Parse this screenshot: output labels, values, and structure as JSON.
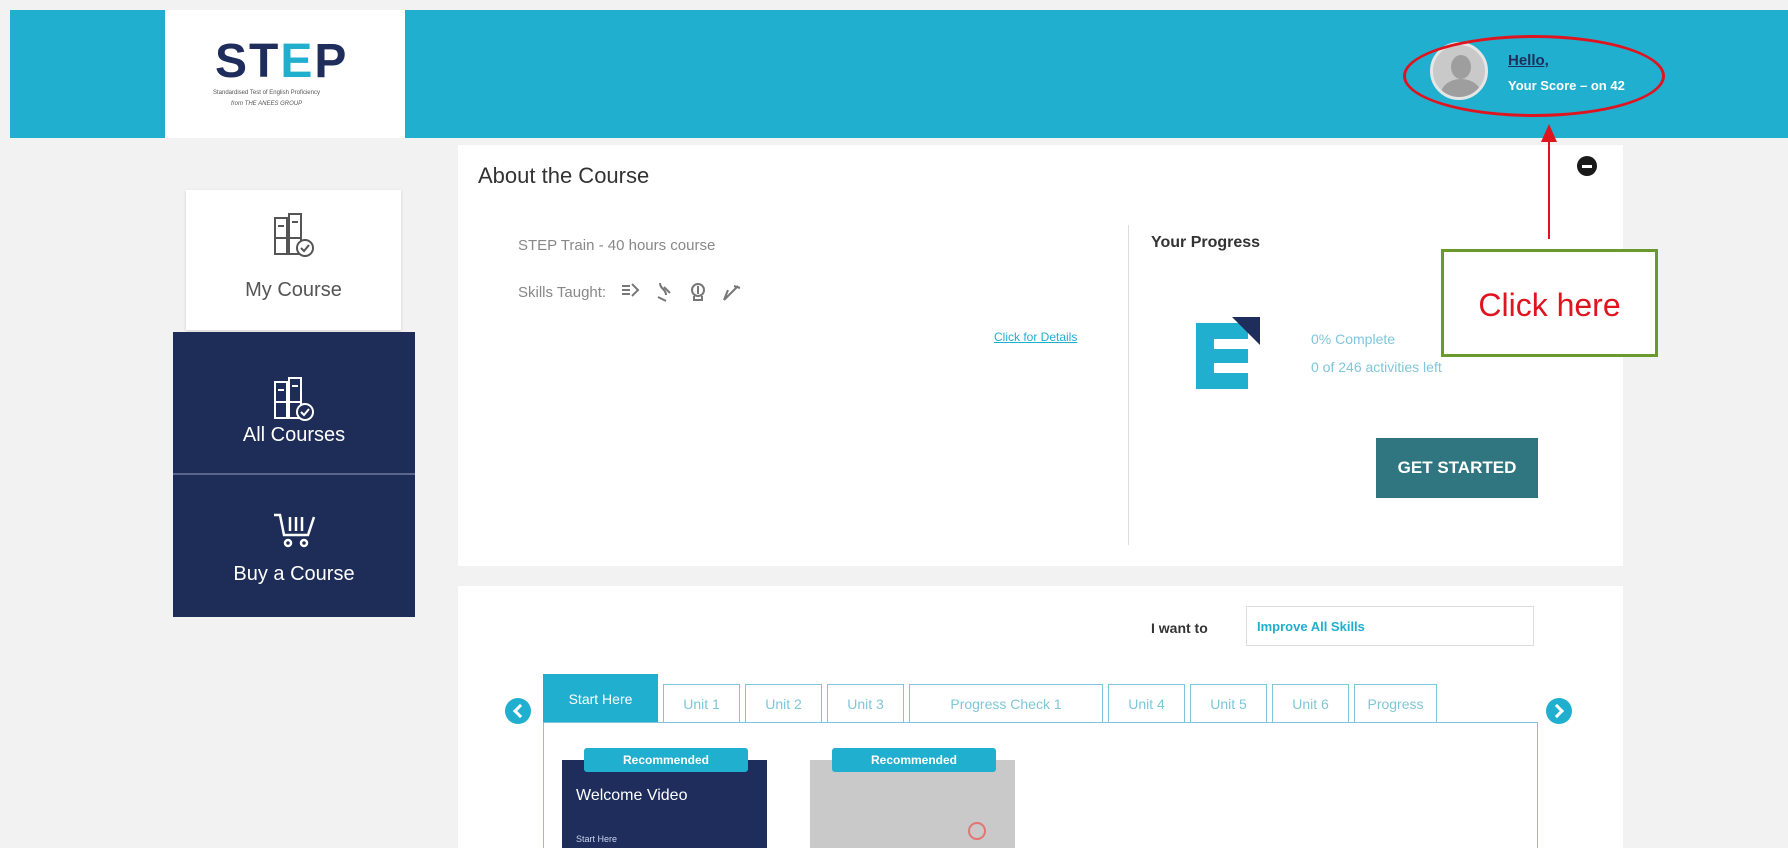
{
  "header": {
    "logo_main": "STEP",
    "logo_tagline": "Standardised Test of English Proficiency",
    "logo_byline": "from THE ANEES GROUP",
    "greeting": "Hello,",
    "score": "Your Score – on 42"
  },
  "sidebar": {
    "my_course": "My Course",
    "all_courses": "All Courses",
    "buy_course": "Buy a Course"
  },
  "about": {
    "title": "About the Course",
    "course_name": "STEP Train - 40 hours course",
    "skills_label": "Skills Taught:",
    "details_link": "Click for Details",
    "progress_title": "Your Progress",
    "percent_complete": "0% Complete",
    "activities_left": "0 of 246 activities left",
    "get_started": "GET STARTED"
  },
  "annotation": {
    "click_here": "Click here"
  },
  "filter": {
    "label": "I want to",
    "value": "Improve All Skills"
  },
  "tabs": [
    {
      "label": "Start Here",
      "width": 115
    },
    {
      "label": "Unit 1",
      "width": 77
    },
    {
      "label": "Unit 2",
      "width": 77
    },
    {
      "label": "Unit 3",
      "width": 77
    },
    {
      "label": "Progress Check 1",
      "width": 194
    },
    {
      "label": "Unit 4",
      "width": 77
    },
    {
      "label": "Unit 5",
      "width": 77
    },
    {
      "label": "Unit 6",
      "width": 77
    },
    {
      "label": "Progress",
      "width": 83
    }
  ],
  "cards": [
    {
      "badge": "Recommended",
      "title": "Welcome Video",
      "sub": "Start Here"
    },
    {
      "badge": "Recommended",
      "title": "",
      "sub": ""
    }
  ],
  "colors": {
    "brand": "#21afd0",
    "navy": "#1e2d57",
    "button": "#2f7680",
    "annotation": "#e0141e"
  }
}
